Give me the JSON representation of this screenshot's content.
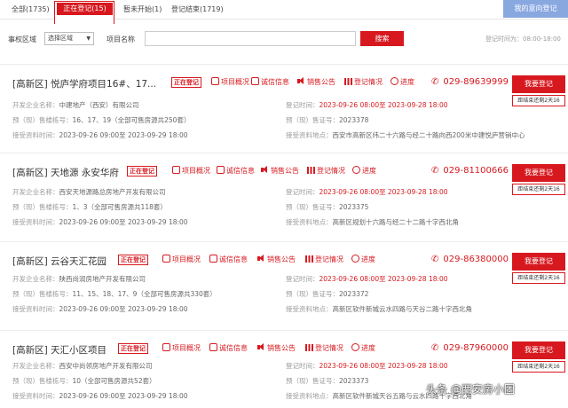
{
  "tabs": [
    {
      "label": "全部(1735)"
    },
    {
      "label": "正在登记(15)"
    },
    {
      "label": "暂未开始(1)"
    },
    {
      "label": "登记结束(1719)"
    }
  ],
  "my_registration": "我的意向登记",
  "filter": {
    "region_label": "事权区域",
    "region_select": "选择区域",
    "name_label": "项目名称",
    "name_value": "",
    "search": "搜索",
    "time_label": "登记时间为：",
    "time_value": "08:00-18:00"
  },
  "labels": {
    "developer": "开发企业名称：",
    "presale": "预（现）售楼栋号：",
    "reg_time": "登记时间：",
    "permit": "预（现）售证号：",
    "receive_time": "接受资料时间：",
    "receive_place": "接受资料地点：",
    "badge": "正在登记",
    "info": "项目概况",
    "credit": "诚信信息",
    "notice": "销售公告",
    "status": "登记情况",
    "progress": "进度",
    "register": "我要登记"
  },
  "listings": [
    {
      "title": "[高新区] 悦庐学府项目16#、17...",
      "phone": "029-89639999",
      "countdown": "距结束还剩2天16",
      "developer": "中建地产（西安）有限公司",
      "buildings": "16、17、19（全部可售房源共250套）",
      "reg_time": "2023-09-26 08:00至 2023-09-28 18:00",
      "permit": "2023378",
      "receive_time": "2023-09-26 09:00至 2023-09-29 18:00",
      "receive_place": "西安市高新区纬二十六路与经二十路向西200米中建悦庐营销中心"
    },
    {
      "title": "[高新区] 天地源 永安华府",
      "phone": "029-81100666",
      "countdown": "距结束还剩2天16",
      "developer": "西安天地源路总房地产开发有限公司",
      "buildings": "1、3（全部可售房源共118套）",
      "reg_time": "2023-09-26 08:00至 2023-09-28 18:00",
      "permit": "2023375",
      "receive_time": "2023-09-26 09:00至 2023-09-29 18:00",
      "receive_place": "高新区规划十六路与经二十二路十字西北角"
    },
    {
      "title": "[高新区] 云谷天汇花园",
      "phone": "029-86380000",
      "countdown": "距结束还剩2天16",
      "developer": "陕西尚润房地产开发有限公司",
      "buildings": "11、15、18、17、9（全部可售房源共330套）",
      "reg_time": "2023-09-26 08:00至 2023-09-28 18:00",
      "permit": "2023372",
      "receive_time": "2023-09-26 09:00至 2023-09-29 18:00",
      "receive_place": "高新区软件新城云水四路与天谷二路十字西北角"
    },
    {
      "title": "[高新区] 天汇小区项目",
      "phone": "029-87960000",
      "countdown": "距结束还剩2天16",
      "developer": "西安中尚领房地产开发有限公司",
      "buildings": "10（全部可售房源共52套）",
      "reg_time": "2023-09-26 08:00至 2023-09-28 18:00",
      "permit": "2023373",
      "receive_time": "2023-09-26 09:00至 2023-09-29 18:00",
      "receive_place": "高新区软件新城天谷五路与云水四路十字西北角"
    }
  ],
  "watermark": "头条 @西安房小团"
}
